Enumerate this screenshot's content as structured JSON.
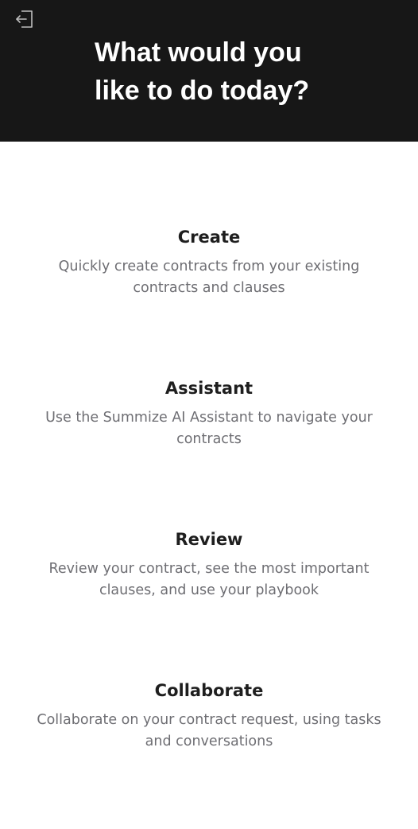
{
  "header": {
    "title_line1": "What would you",
    "title_line2": "like to do today?",
    "exit_icon": "sign-out-icon"
  },
  "options": [
    {
      "title": "Create",
      "description": "Quickly create contracts from your existing contracts and clauses"
    },
    {
      "title": "Assistant",
      "description": "Use the Summize AI Assistant to navigate your contracts"
    },
    {
      "title": "Review",
      "description": "Review your contract, see the most important clauses, and use your playbook"
    },
    {
      "title": "Collaborate",
      "description": "Collaborate on your contract request, using tasks and conversations"
    }
  ],
  "colors": {
    "header_bg": "#171717",
    "title_text": "#1e1e1e",
    "description_text": "#6e6e73"
  }
}
